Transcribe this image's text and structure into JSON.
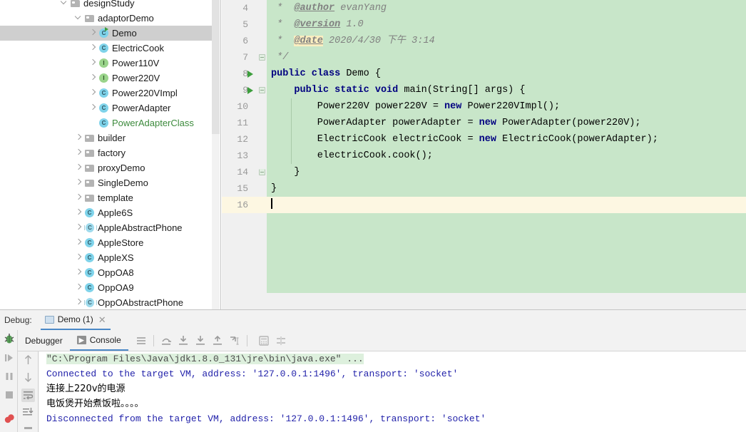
{
  "project_tree": {
    "name": "project-tree",
    "rows": [
      {
        "label": "designStudy",
        "indent": 0,
        "twisty": "down",
        "icon": "folder-icon",
        "selected": false,
        "partial_top": true
      },
      {
        "label": "adaptorDemo",
        "indent": 1,
        "twisty": "down",
        "icon": "folder-icon",
        "selected": false
      },
      {
        "label": "Demo",
        "indent": 2,
        "twisty": "right",
        "icon": "class-runnable-icon",
        "selected": true
      },
      {
        "label": "ElectricCook",
        "indent": 2,
        "twisty": "right",
        "icon": "class-icon",
        "selected": false
      },
      {
        "label": "Power110V",
        "indent": 2,
        "twisty": "right",
        "icon": "interface-icon",
        "selected": false
      },
      {
        "label": "Power220V",
        "indent": 2,
        "twisty": "right",
        "icon": "interface-icon",
        "selected": false
      },
      {
        "label": "Power220VImpl",
        "indent": 2,
        "twisty": "right",
        "icon": "class-icon",
        "selected": false
      },
      {
        "label": "PowerAdapter",
        "indent": 2,
        "twisty": "right",
        "icon": "class-icon",
        "selected": false
      },
      {
        "label": "PowerAdapterClass",
        "indent": 2,
        "twisty": "none",
        "icon": "class-icon",
        "selected": false,
        "green": true
      },
      {
        "label": "builder",
        "indent": 1,
        "twisty": "right",
        "icon": "folder-icon",
        "selected": false
      },
      {
        "label": "factory",
        "indent": 1,
        "twisty": "right",
        "icon": "folder-icon",
        "selected": false
      },
      {
        "label": "proxyDemo",
        "indent": 1,
        "twisty": "right",
        "icon": "folder-icon",
        "selected": false
      },
      {
        "label": "SingleDemo",
        "indent": 1,
        "twisty": "right",
        "icon": "folder-icon",
        "selected": false
      },
      {
        "label": "template",
        "indent": 1,
        "twisty": "right",
        "icon": "folder-icon",
        "selected": false
      },
      {
        "label": "Apple6S",
        "indent": 1,
        "twisty": "right",
        "icon": "class-icon",
        "selected": false
      },
      {
        "label": "AppleAbstractPhone",
        "indent": 1,
        "twisty": "right",
        "icon": "abstract-class-icon",
        "selected": false
      },
      {
        "label": "AppleStore",
        "indent": 1,
        "twisty": "right",
        "icon": "class-icon",
        "selected": false
      },
      {
        "label": "AppleXS",
        "indent": 1,
        "twisty": "right",
        "icon": "class-icon",
        "selected": false
      },
      {
        "label": "OppOA8",
        "indent": 1,
        "twisty": "right",
        "icon": "class-icon",
        "selected": false
      },
      {
        "label": "OppOA9",
        "indent": 1,
        "twisty": "right",
        "icon": "class-icon",
        "selected": false
      },
      {
        "label": "OppOAbstractPhone",
        "indent": 1,
        "twisty": "right",
        "icon": "abstract-class-icon",
        "selected": false
      }
    ]
  },
  "editor": {
    "first_line_number": 4,
    "caret_line_number": 16,
    "lines": [
      {
        "n": 4,
        "run": false,
        "fold": "none",
        "kind": "comment",
        "text": " *  @author evanYang"
      },
      {
        "n": 5,
        "run": false,
        "fold": "none",
        "kind": "comment",
        "text": " *  @version 1.0"
      },
      {
        "n": 6,
        "run": false,
        "fold": "none",
        "kind": "comment",
        "text": " *  @date 2020/4/30 下午 3:14"
      },
      {
        "n": 7,
        "run": false,
        "fold": "start-end",
        "kind": "comment",
        "text": " */"
      },
      {
        "n": 8,
        "run": true,
        "fold": "none",
        "kind": "code",
        "text": "public class Demo {"
      },
      {
        "n": 9,
        "run": true,
        "fold": "start",
        "kind": "code",
        "text": "    public static void main(String[] args) {"
      },
      {
        "n": 10,
        "run": false,
        "fold": "none",
        "kind": "code",
        "text": "        Power220V power220V = new Power220VImpl();"
      },
      {
        "n": 11,
        "run": false,
        "fold": "none",
        "kind": "code",
        "text": "        PowerAdapter powerAdapter = new PowerAdapter(power220V);"
      },
      {
        "n": 12,
        "run": false,
        "fold": "none",
        "kind": "code",
        "text": "        ElectricCook electricCook = new ElectricCook(powerAdapter);"
      },
      {
        "n": 13,
        "run": false,
        "fold": "none",
        "kind": "code",
        "text": "        electricCook.cook();"
      },
      {
        "n": 14,
        "run": false,
        "fold": "end",
        "kind": "code",
        "text": "    }"
      },
      {
        "n": 15,
        "run": false,
        "fold": "none",
        "kind": "code",
        "text": "}"
      },
      {
        "n": 16,
        "run": false,
        "fold": "none",
        "kind": "caret",
        "text": ""
      }
    ],
    "tokens": {
      "javadoc_author_tag": "@author",
      "javadoc_author_value": "evanYang",
      "javadoc_version_tag": "@version",
      "javadoc_version_value": "1.0",
      "javadoc_date_tag": "@date",
      "javadoc_date_value": "2020/4/30 下午 3:14"
    }
  },
  "debug": {
    "panel_label": "Debug:",
    "session_tab": {
      "name": "Demo (1)",
      "close": "✕"
    },
    "tabs": [
      {
        "label": "Debugger",
        "active": false
      },
      {
        "label": "Console",
        "active": true,
        "icon_glyph": "▶"
      }
    ],
    "toolbar_icons": [
      "menu-icon",
      "step-over-icon",
      "step-into-icon",
      "force-step-into-icon",
      "step-out-icon",
      "run-to-cursor-icon",
      "evaluate-expression-icon",
      "settings-icon"
    ],
    "left_rail_icons": [
      "debug-bug-icon",
      "resume-program-icon",
      "pause-program-icon",
      "stop-program-icon",
      "view-breakpoints-icon"
    ],
    "stepper_rail_icons": [
      "scroll-up-icon",
      "scroll-down-icon",
      "soft-wrap-icon",
      "scroll-to-end-icon",
      "print-icon"
    ],
    "console_lines": [
      {
        "kind": "cmdline",
        "highlight": "\"C:\\Program Files\\Java\\jdk1.8.0_131\\jre\\bin\\java.exe\"",
        "rest": " ..."
      },
      {
        "kind": "vm",
        "text": "Connected to the target VM, address: '127.0.0.1:1496', transport: 'socket'"
      },
      {
        "kind": "user",
        "text": "连接上220v的电源"
      },
      {
        "kind": "user",
        "text": "电饭煲开始煮饭啦。。。。"
      },
      {
        "kind": "vm",
        "text": "Disconnected from the target VM, address: '127.0.0.1:1496', transport: 'socket'"
      }
    ]
  },
  "colors": {
    "code_background": "#c8e6c9",
    "caret_line": "#fdf7e2",
    "keyword": "#000080",
    "comment": "#808080",
    "tree_selection": "#cfcfcf",
    "tab_underline": "#4a88c7",
    "console_vm_text": "#2222aa",
    "run_marker_green": "#3c9e3c"
  }
}
